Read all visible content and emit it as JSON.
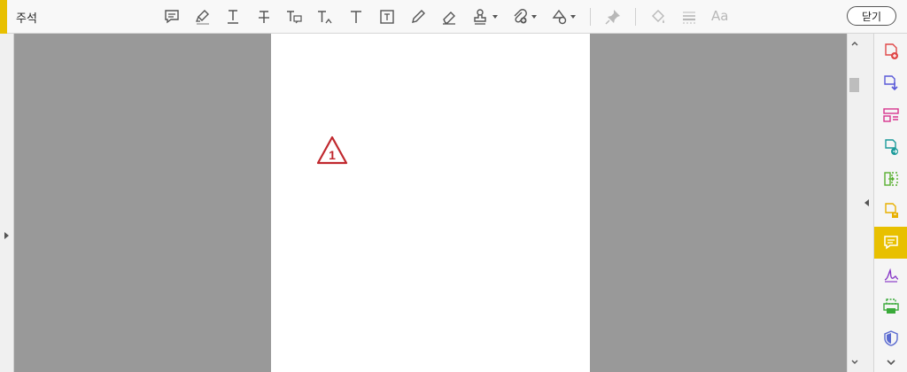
{
  "toolbar": {
    "title": "주석",
    "font_label": "Aa",
    "close_label": "닫기",
    "accent_color": "#e8c000"
  },
  "document": {
    "marker_number": "1",
    "marker_color": "#c0282e"
  },
  "icons": {
    "toolbar": [
      "sticky-note-icon",
      "highlight-icon",
      "underline-text-icon",
      "strikethrough-text-icon",
      "replace-text-icon",
      "insert-text-icon",
      "text-box-icon",
      "text-field-icon",
      "pencil-icon",
      "eraser-icon",
      "stamp-icon",
      "attach-file-icon",
      "shapes-icon",
      "pin-icon",
      "fill-color-icon",
      "line-style-icon"
    ],
    "right_panel": [
      "create-pdf-icon",
      "export-pdf-icon",
      "organize-pages-icon",
      "share-pdf-icon",
      "compress-pdf-icon",
      "edit-pdf-icon",
      "comment-icon",
      "fill-sign-icon",
      "print-production-icon",
      "protect-icon"
    ]
  }
}
